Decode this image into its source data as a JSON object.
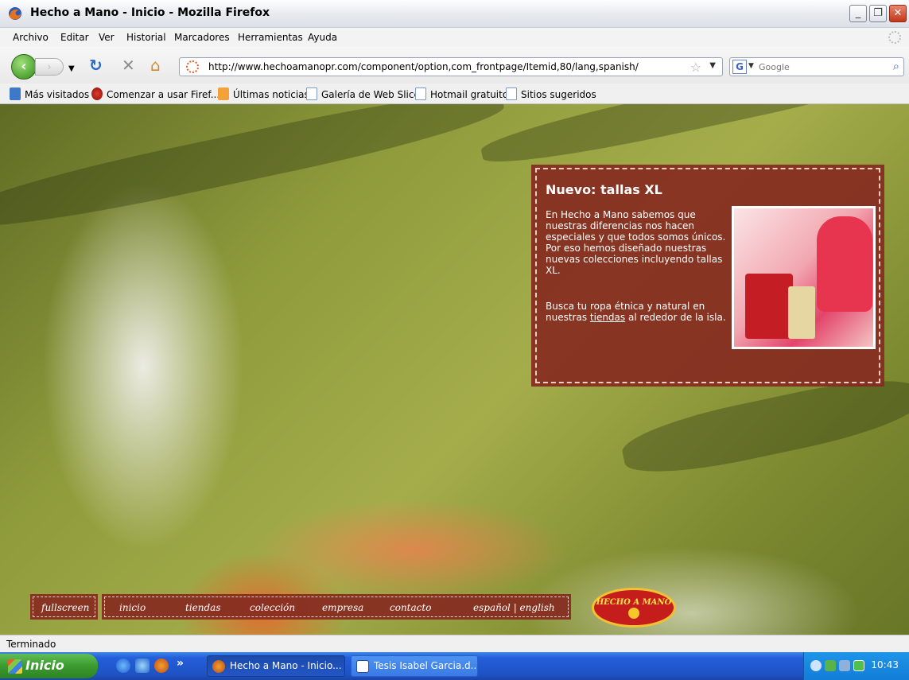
{
  "window": {
    "title": "Hecho a Mano - Inicio - Mozilla Firefox",
    "minimize": "_",
    "restore": "❐",
    "close": "✕"
  },
  "menu": [
    "Archivo",
    "Editar",
    "Ver",
    "Historial",
    "Marcadores",
    "Herramientas",
    "Ayuda"
  ],
  "nav": {
    "url": "http://www.hechoamanopr.com/component/option,com_frontpage/Itemid,80/lang,spanish/",
    "search_placeholder": "Google"
  },
  "bookmarks": [
    "Más visitados",
    "Comenzar a usar Firef...",
    "Últimas noticias",
    "Galería de Web Slice",
    "Hotmail gratuito",
    "Sitios sugeridos"
  ],
  "promo": {
    "heading": "Nuevo: tallas XL",
    "paragraph1": "En Hecho a Mano sabemos que nuestras diferencias nos hacen especiales y que todos somos únicos. Por eso hemos diseñado nuestras nuevas colecciones incluyendo tallas XL.",
    "paragraph2_before": "Busca tu ropa étnica y natural en nuestras ",
    "paragraph2_link": "tiendas",
    "paragraph2_after": " al rededor de la isla."
  },
  "site_nav": {
    "fullscreen": "fullscreen",
    "links": [
      "inicio",
      "tiendas",
      "colección",
      "empresa",
      "contacto"
    ],
    "lang": "español | english"
  },
  "logo_text": "HECHO A MANO",
  "status": "Terminado",
  "taskbar": {
    "start": "Inicio",
    "more": "»",
    "tasks": [
      "Hecho a Mano - Inicio...",
      "Tesis Isabel Garcia.d..."
    ],
    "clock": "10:43"
  },
  "colors": {
    "promo_bg": "#862a21",
    "taskbar_blue": "#245edb",
    "start_green": "#3c9a2e"
  },
  "icons": [
    "firefox-icon",
    "back-arrow-icon",
    "forward-arrow-icon",
    "reload-icon",
    "stop-icon",
    "home-icon",
    "star-icon",
    "google-icon",
    "search-icon"
  ]
}
